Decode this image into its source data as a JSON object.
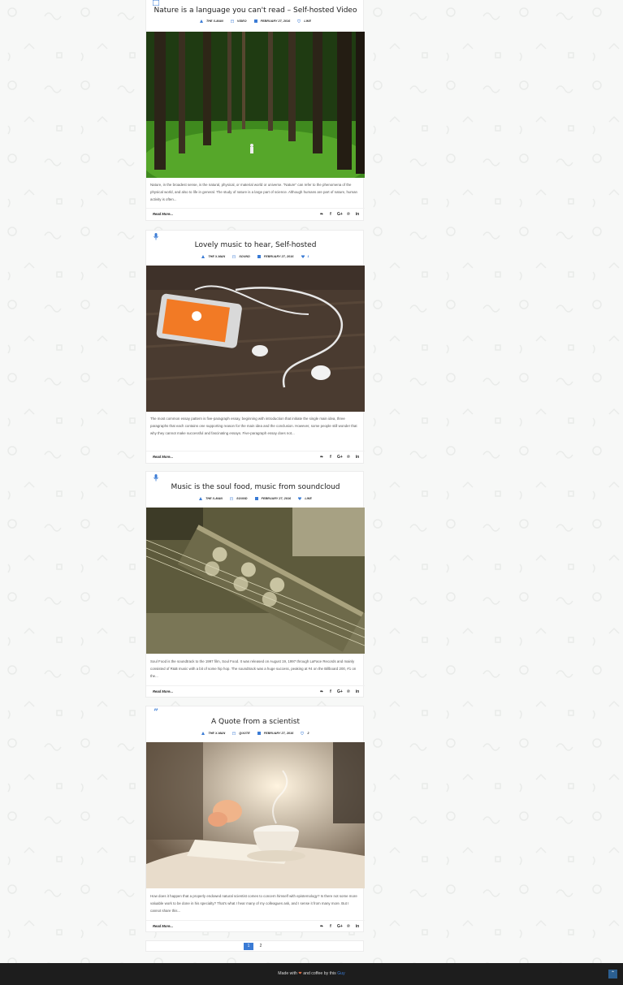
{
  "posts": [
    {
      "type_icon": "video-icon",
      "title": "Nature is a language you can't read – Self-hosted Video",
      "author": "THE X-MAN",
      "category": "VIDEO",
      "date": "FEBRUARY 27, 2016",
      "likes": "LIKE",
      "excerpt": "Nature, in the broadest sense, is the natural, physical, or material world or universe. \"Nature\" can refer to the phenomena of the physical world, and also to life in general. The study of nature is a large part of science. Although humans are part of nature, human activity is often...",
      "read_more": "Read More...",
      "image": "forest-photo"
    },
    {
      "type_icon": "microphone-icon",
      "title": "Lovely music to hear, Self-hosted",
      "author": "THE X-MAN",
      "category": "SOUND",
      "date": "FEBRUARY 27, 2016",
      "likes": "1",
      "excerpt": "The most common essay pattern is five-paragraph essay, beginning with introduction that initiate the single main idea, three paragraphs that each contains one supporting reason for the main idea and the conclusion. However, some people still wonder that why they cannot make successful and fascinating essays. Five-paragraph essay does not...",
      "read_more": "Read More...",
      "image": "phone-earphones-photo"
    },
    {
      "type_icon": "microphone-icon",
      "title": "Music is the soul food, music from soundcloud",
      "author": "THE X-MAN",
      "category": "SOUND",
      "date": "FEBRUARY 27, 2016",
      "likes": "LIKE",
      "excerpt": "Soul Food is the soundtrack to the 1997 film, Soul Food. It was released on August 19, 1997 through LaFace Records and mainly consisted of R&B music with a bit of some hip hop. The soundtrack was a huge success, peaking at #4 on the Billboard 200, #1 on the...",
      "read_more": "Read More...",
      "image": "guitar-headstock-photo"
    },
    {
      "type_icon": "quote-icon",
      "title": "A Quote from a scientist",
      "author": "THE X-MAN",
      "category": "QUOTE",
      "date": "FEBRUARY 27, 2016",
      "likes": "2",
      "excerpt": "How does it happen that a properly endowed natural scientist comes to concern himself with epistemology? Is there not some more valuable work to be done in his specialty? That's what I hear many of my colleagues ask, and I sense it from many more. But I cannot share this...",
      "read_more": "Read More...",
      "image": "teacup-photo"
    }
  ],
  "share_icons": [
    "twitter-icon",
    "facebook-icon",
    "google-plus-icon",
    "pinterest-icon",
    "linkedin-icon"
  ],
  "share_glyphs": [
    "❧",
    "f",
    "G+",
    "℗",
    "in"
  ],
  "pagination": {
    "current": "1",
    "next": "2"
  },
  "footer": {
    "made_with": "Made with",
    "and_coffee": "and coffee by this",
    "guy": "Guy"
  },
  "colors": {
    "accent": "#3a7bd5",
    "footer_bg": "#1d1d1d",
    "heart": "#e8734a"
  }
}
